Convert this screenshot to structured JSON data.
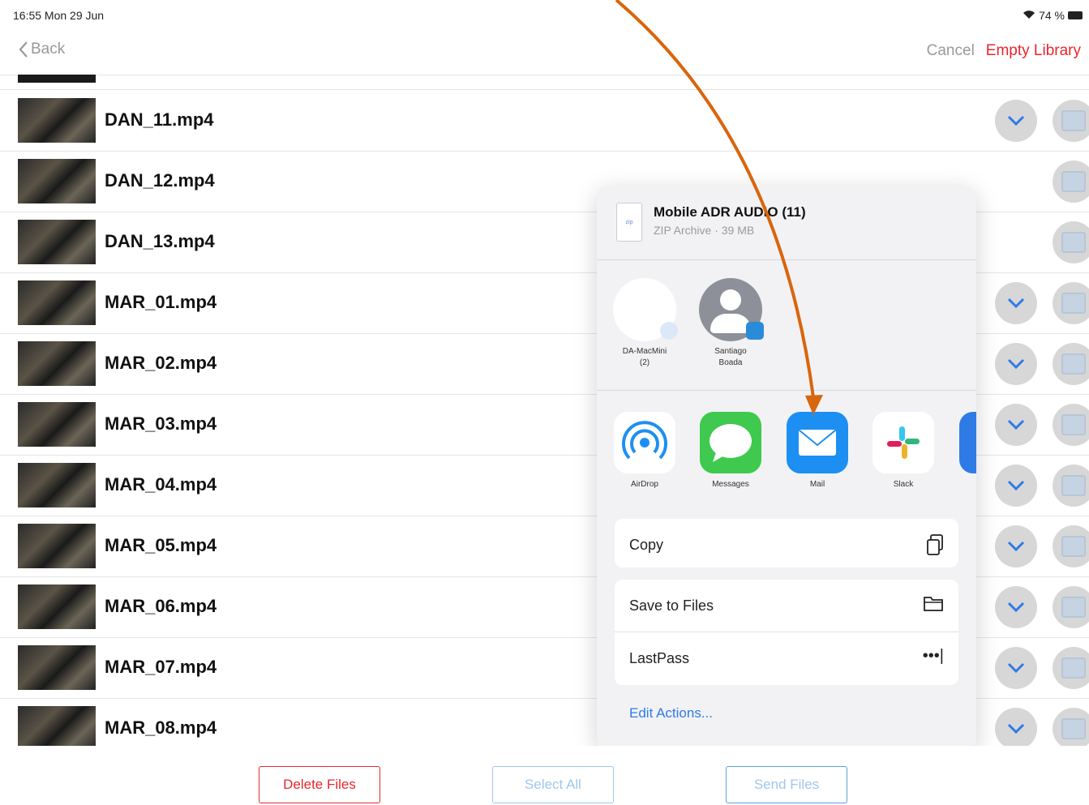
{
  "status": {
    "time": "16:55  Mon 29 Jun",
    "battery": "74 %"
  },
  "nav": {
    "back": "Back",
    "cancel": "Cancel",
    "empty": "Empty Library"
  },
  "files": [
    {
      "name": "DAN_11.mp4",
      "downloadable": true
    },
    {
      "name": "DAN_12.mp4",
      "downloadable": false
    },
    {
      "name": "DAN_13.mp4",
      "downloadable": false
    },
    {
      "name": "MAR_01.mp4",
      "downloadable": true
    },
    {
      "name": "MAR_02.mp4",
      "downloadable": true
    },
    {
      "name": "MAR_03.mp4",
      "downloadable": true
    },
    {
      "name": "MAR_04.mp4",
      "downloadable": true
    },
    {
      "name": "MAR_05.mp4",
      "downloadable": true
    },
    {
      "name": "MAR_06.mp4",
      "downloadable": true
    },
    {
      "name": "MAR_07.mp4",
      "downloadable": true
    },
    {
      "name": "MAR_08.mp4",
      "downloadable": true
    }
  ],
  "share": {
    "file_icon_label": "zip",
    "title": "Mobile ADR AUDIO (11)",
    "subtitle": "ZIP Archive · 39 MB",
    "contacts": [
      {
        "name_line1": "DA-MacMini",
        "name_line2": "(2)"
      },
      {
        "name_line1": "Santiago",
        "name_line2": "Boada"
      }
    ],
    "apps": [
      "AirDrop",
      "Messages",
      "Mail",
      "Slack"
    ],
    "actions": {
      "copy": "Copy",
      "save": "Save to Files",
      "lastpass": "LastPass",
      "lastpass_icon": "•••|"
    },
    "edit": "Edit Actions..."
  },
  "bottom": {
    "delete": "Delete Files",
    "select_all": "Select All",
    "send": "Send Files"
  },
  "colors": {
    "accent_red": "#e8262c",
    "accent_blue": "#2f7be6",
    "annotation_arrow": "#d9650c"
  }
}
